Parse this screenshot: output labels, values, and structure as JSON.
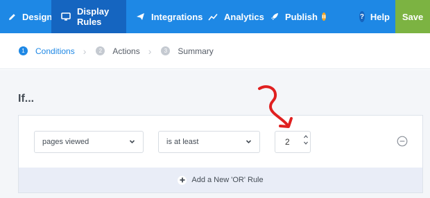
{
  "nav": {
    "design": "Design",
    "display_rules": "Display Rules",
    "integrations": "Integrations",
    "analytics": "Analytics",
    "publish": "Publish",
    "help": "Help",
    "help_icon": "?",
    "save": "Save"
  },
  "steps": [
    {
      "num": "1",
      "label": "Conditions"
    },
    {
      "num": "2",
      "label": "Actions"
    },
    {
      "num": "3",
      "label": "Summary"
    }
  ],
  "rule": {
    "heading": "If...",
    "field": "pages viewed",
    "operator": "is at least",
    "value": "2",
    "add_or_label": "Add a New 'OR' Rule"
  },
  "colors": {
    "nav_bg": "#1e88e5",
    "nav_active": "#1565c0",
    "save_bg": "#7cb342",
    "publish_badge": "#f5a623",
    "annotation_arrow": "#e02020"
  }
}
